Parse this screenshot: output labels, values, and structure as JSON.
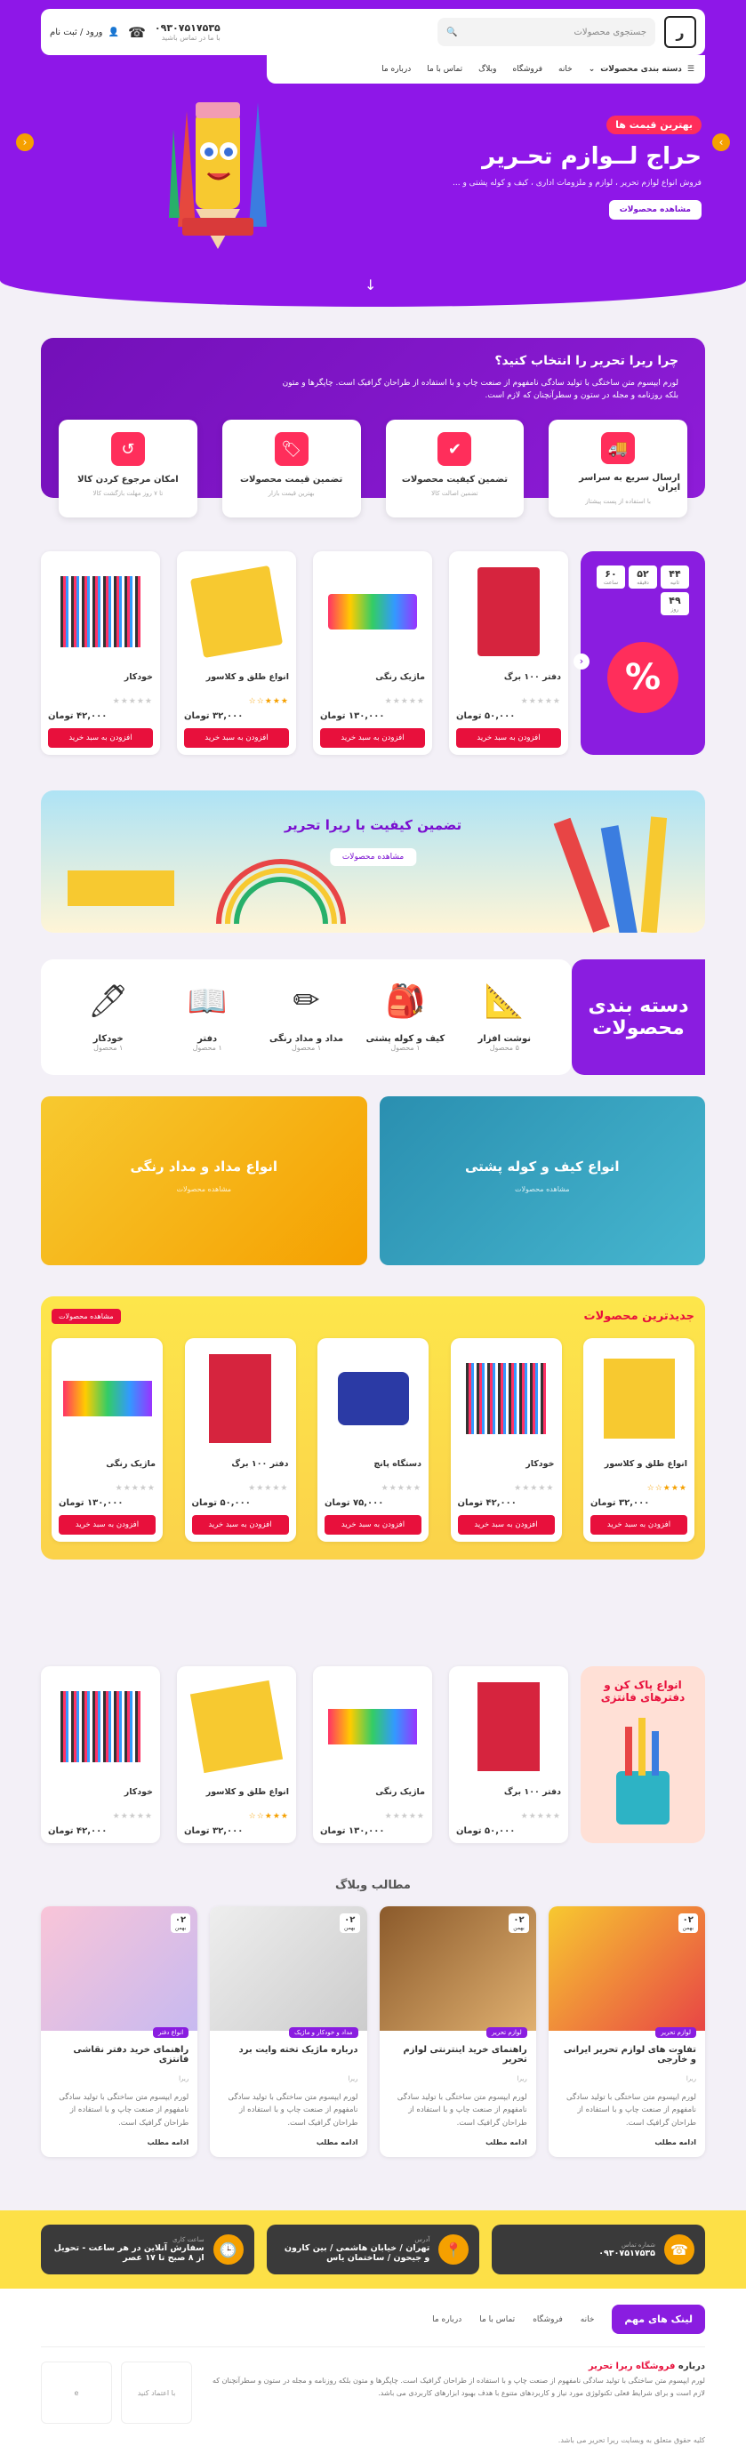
{
  "header": {
    "logo": "ر",
    "search_placeholder": "جستجوی محصولات",
    "phone": "۰۹۳۰۷۵۱۷۵۳۵",
    "phone_sub": "با ما در تماس باشید",
    "login": "ورود / ثبت نام"
  },
  "nav": {
    "category": "دسته بندی محصولات",
    "items": [
      "خانه",
      "فروشگاه",
      "وبلاگ",
      "تماس با ما",
      "درباره ما"
    ]
  },
  "hero": {
    "badge": "بهترین قیمت ها",
    "title": "حراج لــوازم تحـریر",
    "subtitle": "فروش انواع لوازم تحریر ، لوازم و ملزومات اداری ، کیف و کوله پشتی و ...",
    "button": "مشاهده محصولات"
  },
  "why": {
    "title": "چرا ریرا تحریر را انتخاب کنید؟",
    "text": "لورم ایپسوم متن ساختگی با تولید سادگی نامفهوم از صنعت چاپ و با استفاده از طراحان گرافیک است. چاپگرها و متون بلکه روزنامه و مجله در ستون و سطرآنچنان که لازم است.",
    "features": [
      {
        "title": "ارسال سریع به سراسر ایران",
        "sub": "با استفاده از پست پیشتاز"
      },
      {
        "title": "تضمین کیفیت محصولات",
        "sub": "تضمین اصالت کالا"
      },
      {
        "title": "تضمین قیمت محصولات",
        "sub": "بهترین قیمت بازار"
      },
      {
        "title": "امکان مرجوع کردن کالا",
        "sub": "تا ۷ روز مهلت بازگشت کالا"
      }
    ]
  },
  "sale": {
    "countdown": [
      {
        "v": "۴۴",
        "l": "ثانیه"
      },
      {
        "v": "۵۲",
        "l": "دقیقه"
      },
      {
        "v": "۶۰",
        "l": "ساعت"
      },
      {
        "v": "۴۹",
        "l": "روز"
      }
    ],
    "products": [
      {
        "name": "دفتر ۱۰۰ برگ",
        "price": "۵۰,۰۰۰ تومان",
        "stars": 0
      },
      {
        "name": "ماژیک رنگی",
        "price": "۱۳۰,۰۰۰ تومان",
        "stars": 0
      },
      {
        "name": "انواع طلق و کلاسور",
        "price": "۳۲,۰۰۰ تومان",
        "stars": 3
      },
      {
        "name": "خودکار",
        "price": "۴۲,۰۰۰ تومان",
        "stars": 0
      }
    ],
    "cart": "افزودن به سبد خرید"
  },
  "banner": {
    "title": "تضمین کیفیت با ریرا تحریر",
    "button": "مشاهده محصولات"
  },
  "categories": {
    "title1": "دسته بندی",
    "title2": "محصولات",
    "items": [
      {
        "name": "نوشت افزار",
        "count": "۵ محصول"
      },
      {
        "name": "کیف و کوله پشتی",
        "count": "۱ محصول"
      },
      {
        "name": "مداد و مداد رنگی",
        "count": "۱ محصول"
      },
      {
        "name": "دفتر",
        "count": "۱ محصول"
      },
      {
        "name": "خودکار",
        "count": "۱ محصول"
      }
    ]
  },
  "twobanners": [
    {
      "title": "انواع کیف و کوله پشتی",
      "sub": "مشاهده محصولات"
    },
    {
      "title": "انواع مداد و مداد رنگی",
      "sub": "مشاهده محصولات"
    }
  ],
  "newest": {
    "title": "جدیدترین محصولات",
    "button": "مشاهده محصولات",
    "products": [
      {
        "name": "انواع طلق و کلاسور",
        "price": "۳۲,۰۰۰ تومان",
        "stars": 3
      },
      {
        "name": "خودکار",
        "price": "۴۲,۰۰۰ تومان",
        "stars": 0
      },
      {
        "name": "دستگاه پانچ",
        "price": "۷۵,۰۰۰ تومان",
        "stars": 0
      },
      {
        "name": "دفتر ۱۰۰ برگ",
        "price": "۵۰,۰۰۰ تومان",
        "stars": 0
      },
      {
        "name": "ماژیک رنگی",
        "price": "۱۳۰,۰۰۰ تومان",
        "stars": 0
      }
    ]
  },
  "fancy": {
    "title": "انواع پاک کن و دفترهای فانتزی",
    "products": [
      {
        "name": "دفتر ۱۰۰ برگ",
        "price": "۵۰,۰۰۰ تومان",
        "stars": 0
      },
      {
        "name": "ماژیک رنگی",
        "price": "۱۳۰,۰۰۰ تومان",
        "stars": 0
      },
      {
        "name": "انواع طلق و کلاسور",
        "price": "۳۲,۰۰۰ تومان",
        "stars": 3
      },
      {
        "name": "خودکار",
        "price": "۴۲,۰۰۰ تومان",
        "stars": 0
      }
    ]
  },
  "blog": {
    "title": "مطالب وبلاگ",
    "posts": [
      {
        "day": "۰۲",
        "month": "بهمن",
        "tag": "لوازم تحریر",
        "title": "تفاوت های لوازم تحریر ایرانی و خارجی",
        "meta": "ریرا",
        "excerpt": "لورم ایپسوم متن ساختگی با تولید سادگی نامفهوم از صنعت چاپ و با استفاده از طراحان گرافیک است."
      },
      {
        "day": "۰۲",
        "month": "بهمن",
        "tag": "لوازم تحریر",
        "title": "راهنمای خرید اینترنتی لوازم تحریر",
        "meta": "ریرا",
        "excerpt": "لورم ایپسوم متن ساختگی با تولید سادگی نامفهوم از صنعت چاپ و با استفاده از طراحان گرافیک است."
      },
      {
        "day": "۰۲",
        "month": "بهمن",
        "tag": "مداد و خودکار و ماژیک",
        "title": "درباره ماژیک تخته وایت برد",
        "meta": "ریرا",
        "excerpt": "لورم ایپسوم متن ساختگی با تولید سادگی نامفهوم از صنعت چاپ و با استفاده از طراحان گرافیک است."
      },
      {
        "day": "۰۲",
        "month": "بهمن",
        "tag": "انواع دفتر",
        "title": "راهنمای خرید دفتر نقاشی فانتزی",
        "meta": "ریرا",
        "excerpt": "لورم ایپسوم متن ساختگی با تولید سادگی نامفهوم از صنعت چاپ و با استفاده از طراحان گرافیک است."
      }
    ],
    "more": "ادامه مطلب"
  },
  "info": [
    {
      "label": "شماره تماس",
      "value": "۰۹۳۰۷۵۱۷۵۳۵"
    },
    {
      "label": "آدرس",
      "value": "تهران / خیابان هاشمی / بین کارون و جیحون / ساختمان یاس"
    },
    {
      "label": "ساعت کاری",
      "value": "سفارش آنلاین در هر ساعت - تحویل از ۸ صبح تا ۱۷ عصر"
    }
  ],
  "footer": {
    "links_title": "لینک های مهم",
    "links": [
      "خانه",
      "فروشگاه",
      "تماس با ما",
      "درباره ما"
    ],
    "about_title_pre": "درباره ",
    "about_title_brand": "فروشگاه ریرا تحریر",
    "about": "لورم ایپسوم متن ساختگی با تولید سادگی نامفهوم از صنعت چاپ و با استفاده از طراحان گرافیک است. چاپگرها و متون بلکه روزنامه و مجله در ستون و سطرآنچنان که لازم است و برای شرایط فعلی تکنولوژی مورد نیاز و کاربردهای متنوع با هدف بهبود ابزارهای کاربردی می باشد.",
    "trust": "با اعتماد کنید",
    "copyright": "کلیه حقوق متعلق به وبسایت ریرا تحریر می باشد."
  }
}
